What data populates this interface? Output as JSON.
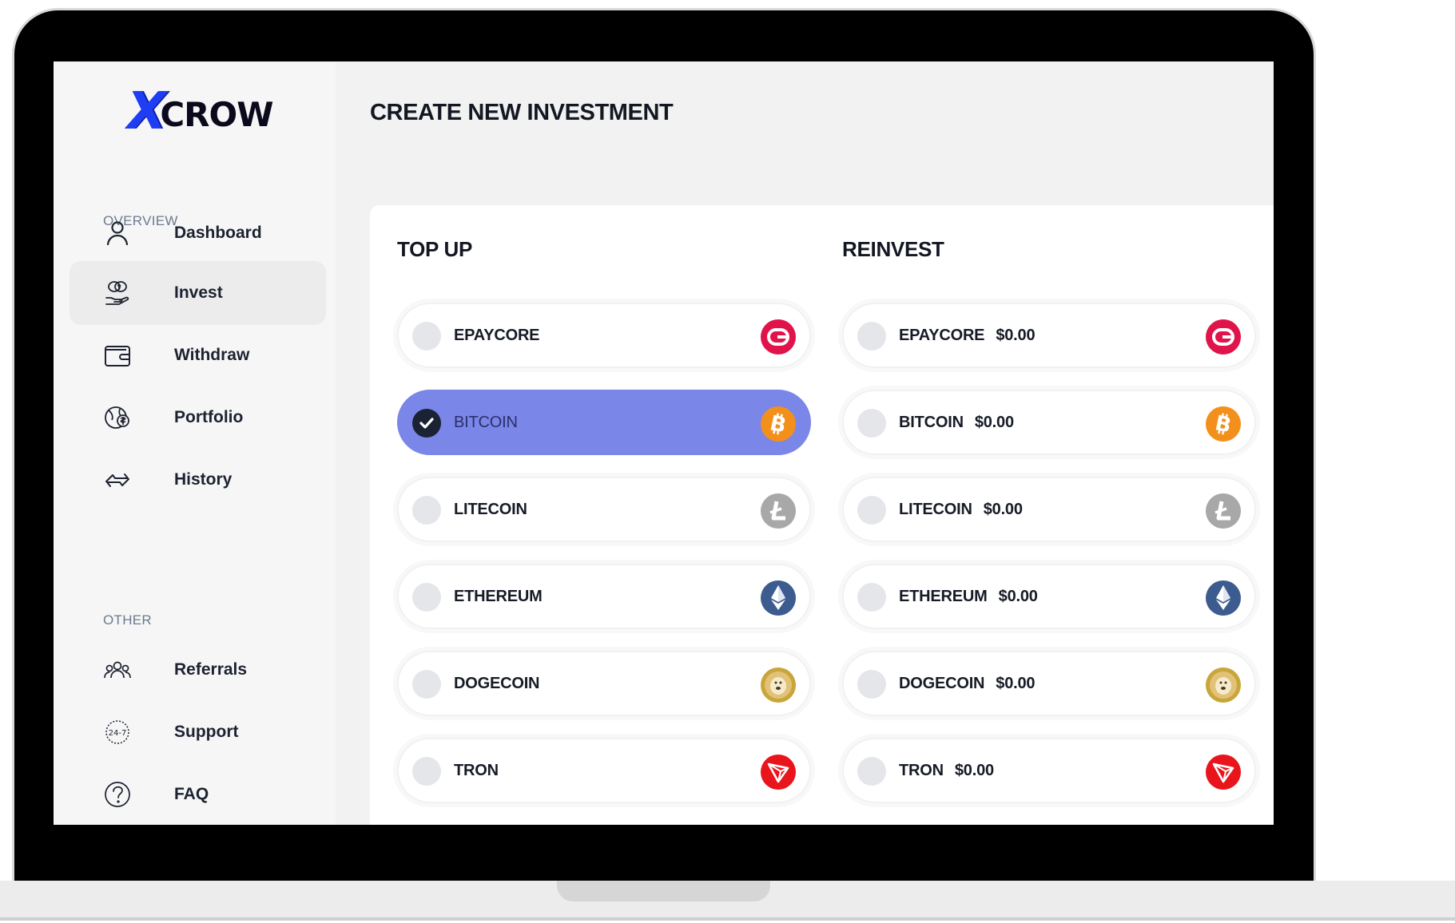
{
  "app": {
    "logo_mark": "X",
    "logo_text": "CROW",
    "brand_color": "#1f3df2",
    "accent_color": "#7a86e8"
  },
  "sidebar": {
    "overview_title": "OVERVIEW",
    "other_title": "OTHER",
    "items": [
      {
        "label": "Dashboard",
        "icon": "user-icon"
      },
      {
        "label": "Invest",
        "icon": "money-hand-icon",
        "active": true
      },
      {
        "label": "Withdraw",
        "icon": "wallet-icon"
      },
      {
        "label": "Portfolio",
        "icon": "globe-dollar-icon"
      },
      {
        "label": "History",
        "icon": "arrows-swap-icon"
      }
    ],
    "other_items": [
      {
        "label": "Referrals",
        "icon": "users-icon"
      },
      {
        "label": "Support",
        "icon": "support-24-7-icon"
      },
      {
        "label": "FAQ",
        "icon": "question-icon"
      }
    ]
  },
  "main": {
    "title": "CREATE NEW INVESTMENT",
    "top_up": {
      "title": "TOP UP",
      "options": [
        {
          "label": "EPAYCORE",
          "coin": "epaycore-icon",
          "color": "#e0134a"
        },
        {
          "label": "BITCOIN",
          "coin": "bitcoin-icon",
          "color": "#f3901c",
          "selected": true
        },
        {
          "label": "LITECOIN",
          "coin": "litecoin-icon",
          "color": "#a8a8a8"
        },
        {
          "label": "ETHEREUM",
          "coin": "ethereum-icon",
          "color": "#3c5b8e"
        },
        {
          "label": "DOGECOIN",
          "coin": "dogecoin-icon",
          "color": "#c9a63a"
        },
        {
          "label": "TRON",
          "coin": "tron-icon",
          "color": "#e9151d"
        }
      ]
    },
    "reinvest": {
      "title": "REINVEST",
      "options": [
        {
          "label": "EPAYCORE",
          "amount": "$0.00",
          "coin": "epaycore-icon"
        },
        {
          "label": "BITCOIN",
          "amount": "$0.00",
          "coin": "bitcoin-icon"
        },
        {
          "label": "LITECOIN",
          "amount": "$0.00",
          "coin": "litecoin-icon"
        },
        {
          "label": "ETHEREUM",
          "amount": "$0.00",
          "coin": "ethereum-icon"
        },
        {
          "label": "DOGECOIN",
          "amount": "$0.00",
          "coin": "dogecoin-icon"
        },
        {
          "label": "TRON",
          "amount": "$0.00",
          "coin": "tron-icon"
        }
      ]
    }
  }
}
